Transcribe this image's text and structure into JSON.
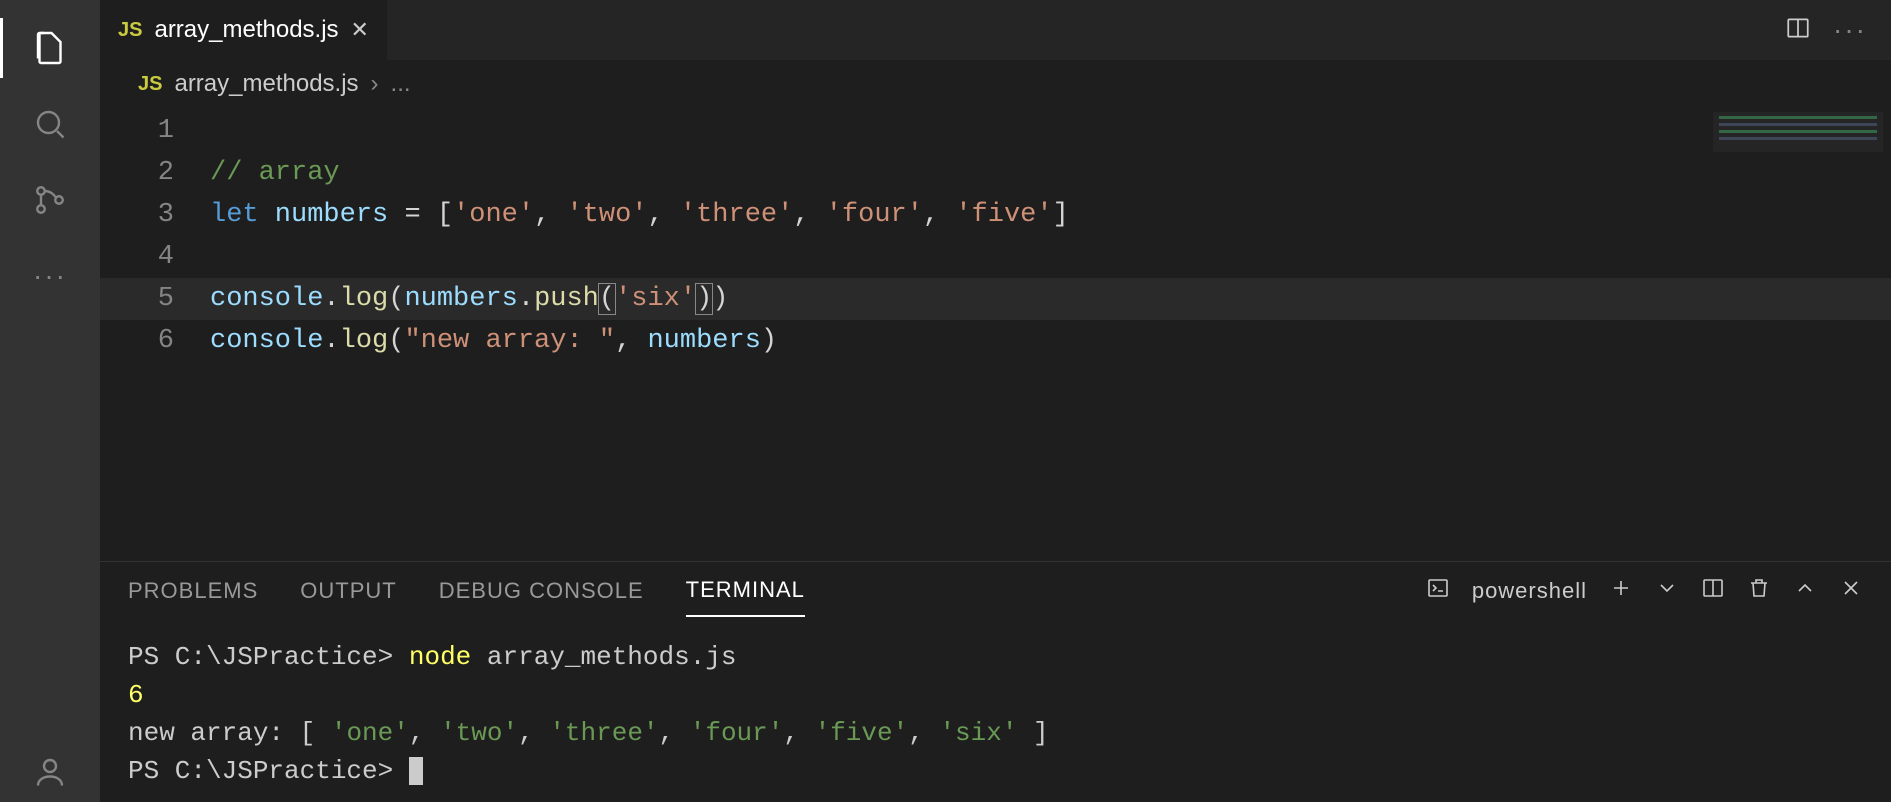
{
  "tab": {
    "badge": "JS",
    "filename": "array_methods.js"
  },
  "breadcrumb": {
    "badge": "JS",
    "filename": "array_methods.js",
    "chevron": "›",
    "rest": "..."
  },
  "editor": {
    "lines": [
      "1",
      "2",
      "3",
      "4",
      "5",
      "6"
    ],
    "l2_comment": "// array",
    "l3_let": "let",
    "l3_var": " numbers ",
    "l3_eq": "= [",
    "l3_s1": "'one'",
    "l3_c1": ", ",
    "l3_s2": "'two'",
    "l3_c2": ", ",
    "l3_s3": "'three'",
    "l3_c3": ", ",
    "l3_s4": "'four'",
    "l3_c4": ", ",
    "l3_s5": "'five'",
    "l3_end": "]",
    "l5_obj": "console",
    "l5_dot1": ".",
    "l5_log": "log",
    "l5_p1": "(",
    "l5_var": "numbers",
    "l5_dot2": ".",
    "l5_push": "push",
    "l5_p2": "(",
    "l5_str": "'six'",
    "l5_p3": ")",
    "l5_p4": ")",
    "l6_obj": "console",
    "l6_dot1": ".",
    "l6_log": "log",
    "l6_p1": "(",
    "l6_str": "\"new array: \"",
    "l6_c": ", ",
    "l6_var": "numbers",
    "l6_p2": ")"
  },
  "panel": {
    "tabs": {
      "problems": "PROBLEMS",
      "output": "OUTPUT",
      "debug": "DEBUG CONSOLE",
      "terminal": "TERMINAL"
    },
    "shell": "powershell"
  },
  "terminal": {
    "prompt1_pre": "PS C:\\JSPractice> ",
    "prompt1_cmd": "node",
    "prompt1_arg": " array_methods.js",
    "out_num": "6",
    "out2_pre": "new array:  [ ",
    "out2_s1": "'one'",
    "out2_c": ", ",
    "out2_s2": "'two'",
    "out2_s3": "'three'",
    "out2_s4": "'four'",
    "out2_s5": "'five'",
    "out2_s6": "'six'",
    "out2_end": " ]",
    "prompt2": "PS C:\\JSPractice> "
  }
}
